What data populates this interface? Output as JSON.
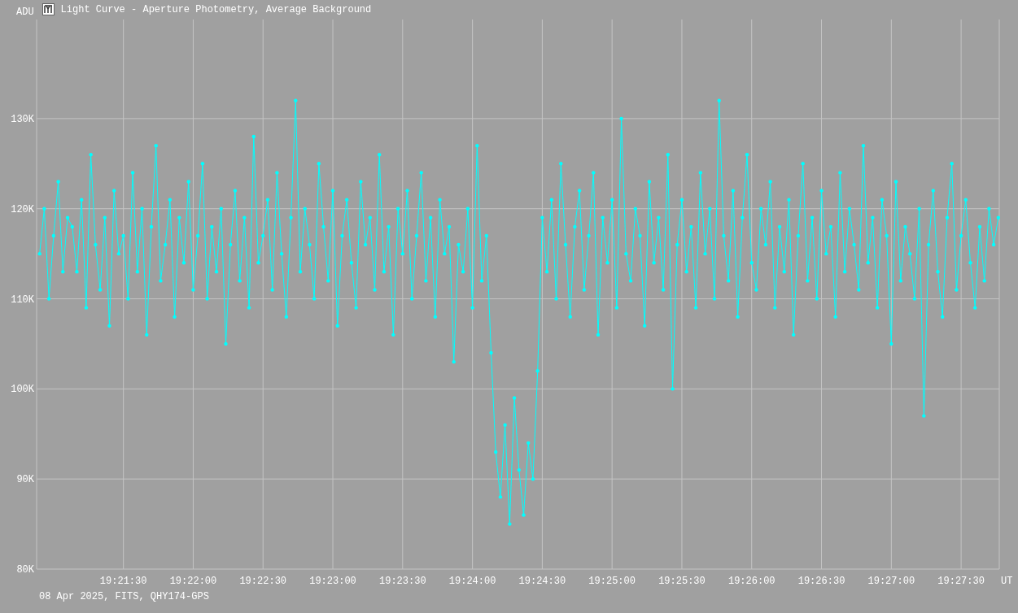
{
  "window": {
    "title": "Light Curve - Aperture Photometry, Average Background"
  },
  "chart": {
    "chart_data": {
      "type": "line",
      "grid": true,
      "ylabel": "ADU",
      "xlabel": "UT",
      "ylim": [
        80,
        141
      ],
      "yticks": [
        {
          "value": 80,
          "label": "80K"
        },
        {
          "value": 90,
          "label": "90K"
        },
        {
          "value": 100,
          "label": "100K"
        },
        {
          "value": 110,
          "label": "110K"
        },
        {
          "value": 120,
          "label": "120K"
        },
        {
          "value": 130,
          "label": "130K"
        }
      ],
      "categories": [
        null,
        null,
        null,
        null,
        null,
        null,
        null,
        null,
        null,
        null,
        null,
        null,
        null,
        null,
        null,
        null,
        null,
        null,
        "19:21:30",
        null,
        null,
        null,
        null,
        null,
        null,
        null,
        null,
        null,
        null,
        null,
        null,
        null,
        null,
        "19:22:00",
        null,
        null,
        null,
        null,
        null,
        null,
        null,
        null,
        null,
        null,
        null,
        null,
        null,
        null,
        "19:22:30",
        null,
        null,
        null,
        null,
        null,
        null,
        null,
        null,
        null,
        null,
        null,
        null,
        null,
        null,
        "19:23:00",
        null,
        null,
        null,
        null,
        null,
        null,
        null,
        null,
        null,
        null,
        null,
        null,
        null,
        null,
        "19:23:30",
        null,
        null,
        null,
        null,
        null,
        null,
        null,
        null,
        null,
        null,
        null,
        null,
        null,
        null,
        "19:24:00",
        null,
        null,
        null,
        null,
        null,
        null,
        null,
        null,
        null,
        null,
        null,
        null,
        null,
        null,
        "19:24:30",
        null,
        null,
        null,
        null,
        null,
        null,
        null,
        null,
        null,
        null,
        null,
        null,
        null,
        null,
        "19:25:00",
        null,
        null,
        null,
        null,
        null,
        null,
        null,
        null,
        null,
        null,
        null,
        null,
        null,
        null,
        "19:25:30",
        null,
        null,
        null,
        null,
        null,
        null,
        null,
        null,
        null,
        null,
        null,
        null,
        null,
        null,
        "19:26:00",
        null,
        null,
        null,
        null,
        null,
        null,
        null,
        null,
        null,
        null,
        null,
        null,
        null,
        null,
        "19:26:30",
        null,
        null,
        null,
        null,
        null,
        null,
        null,
        null,
        null,
        null,
        null,
        null,
        null,
        null,
        "19:27:00",
        null,
        null,
        null,
        null,
        null,
        null,
        null,
        null,
        null,
        null,
        null,
        null,
        null,
        null,
        "19:27:30",
        null,
        null,
        null,
        null,
        null,
        null,
        null,
        null
      ],
      "series": [
        {
          "color": "#00ffff",
          "values": [
            115,
            120,
            110,
            117,
            123,
            113,
            119,
            118,
            113,
            121,
            109,
            126,
            116,
            111,
            119,
            107,
            122,
            115,
            117,
            110,
            124,
            113,
            120,
            106,
            118,
            127,
            112,
            116,
            121,
            108,
            119,
            114,
            123,
            111,
            117,
            125,
            110,
            118,
            113,
            120,
            105,
            116,
            122,
            112,
            119,
            109,
            128,
            114,
            117,
            121,
            111,
            124,
            115,
            108,
            119,
            132,
            113,
            120,
            116,
            110,
            125,
            118,
            112,
            122,
            107,
            117,
            121,
            114,
            109,
            123,
            116,
            119,
            111,
            126,
            113,
            118,
            106,
            120,
            115,
            122,
            110,
            117,
            124,
            112,
            119,
            108,
            121,
            115,
            118,
            103,
            116,
            113,
            120,
            109,
            127,
            112,
            117,
            104,
            93,
            88,
            96,
            85,
            99,
            91,
            86,
            94,
            90,
            102,
            119,
            113,
            121,
            110,
            125,
            116,
            108,
            118,
            122,
            111,
            117,
            124,
            106,
            119,
            114,
            121,
            109,
            130,
            115,
            112,
            120,
            117,
            107,
            123,
            114,
            119,
            111,
            126,
            100,
            116,
            121,
            113,
            118,
            109,
            124,
            115,
            120,
            110,
            132,
            117,
            112,
            122,
            108,
            119,
            126,
            114,
            111,
            120,
            116,
            123,
            109,
            118,
            113,
            121,
            106,
            117,
            125,
            112,
            119,
            110,
            122,
            115,
            118,
            108,
            124,
            113,
            120,
            116,
            111,
            127,
            114,
            119,
            109,
            121,
            117,
            105,
            123,
            112,
            118,
            115,
            110,
            120,
            97,
            116,
            122,
            113,
            108,
            119,
            125,
            111,
            117,
            121,
            114,
            109,
            118,
            112,
            120,
            116,
            119
          ]
        }
      ]
    }
  },
  "footer": "08 Apr 2025, FITS, QHY174-GPS"
}
